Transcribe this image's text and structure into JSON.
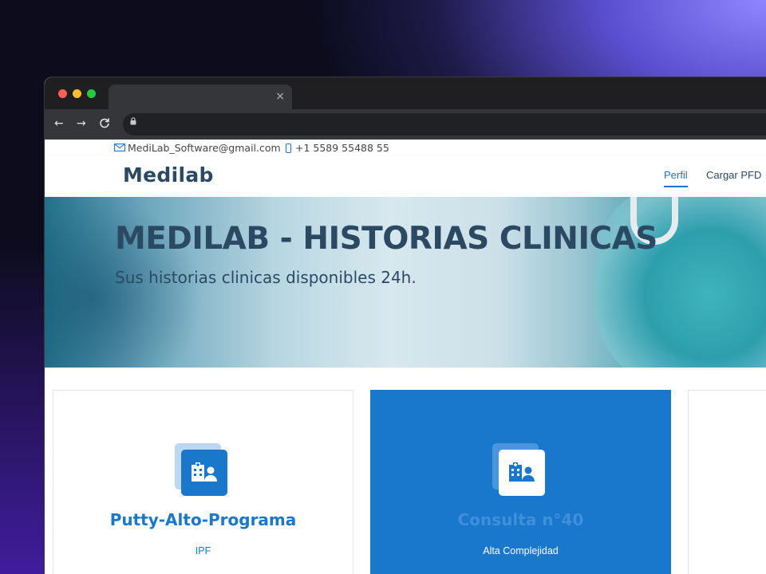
{
  "browser": {
    "tab_close": "×",
    "back": "←",
    "forward": "→",
    "reload": "C",
    "lock": "🔒"
  },
  "topbar": {
    "email": "MediLab_Software@gmail.com",
    "phone": "+1 5589 55488 55"
  },
  "header": {
    "logo": "Medilab",
    "menu": [
      "Perfil",
      "Cargar PFD"
    ]
  },
  "hero": {
    "title": "MEDILAB - HISTORIAS CLINICAS",
    "subtitle": "Sus historias clinicas disponibles 24h."
  },
  "cards": [
    {
      "title": "Putty-Alto-Programa",
      "subtitle": "IPF",
      "icon": "hospital-user-icon"
    },
    {
      "title": "Consulta n°40",
      "subtitle": "Alta Complejidad",
      "icon": "hospital-user-icon"
    }
  ],
  "colors": {
    "accent": "#1977cc",
    "heading": "#2c4964"
  }
}
